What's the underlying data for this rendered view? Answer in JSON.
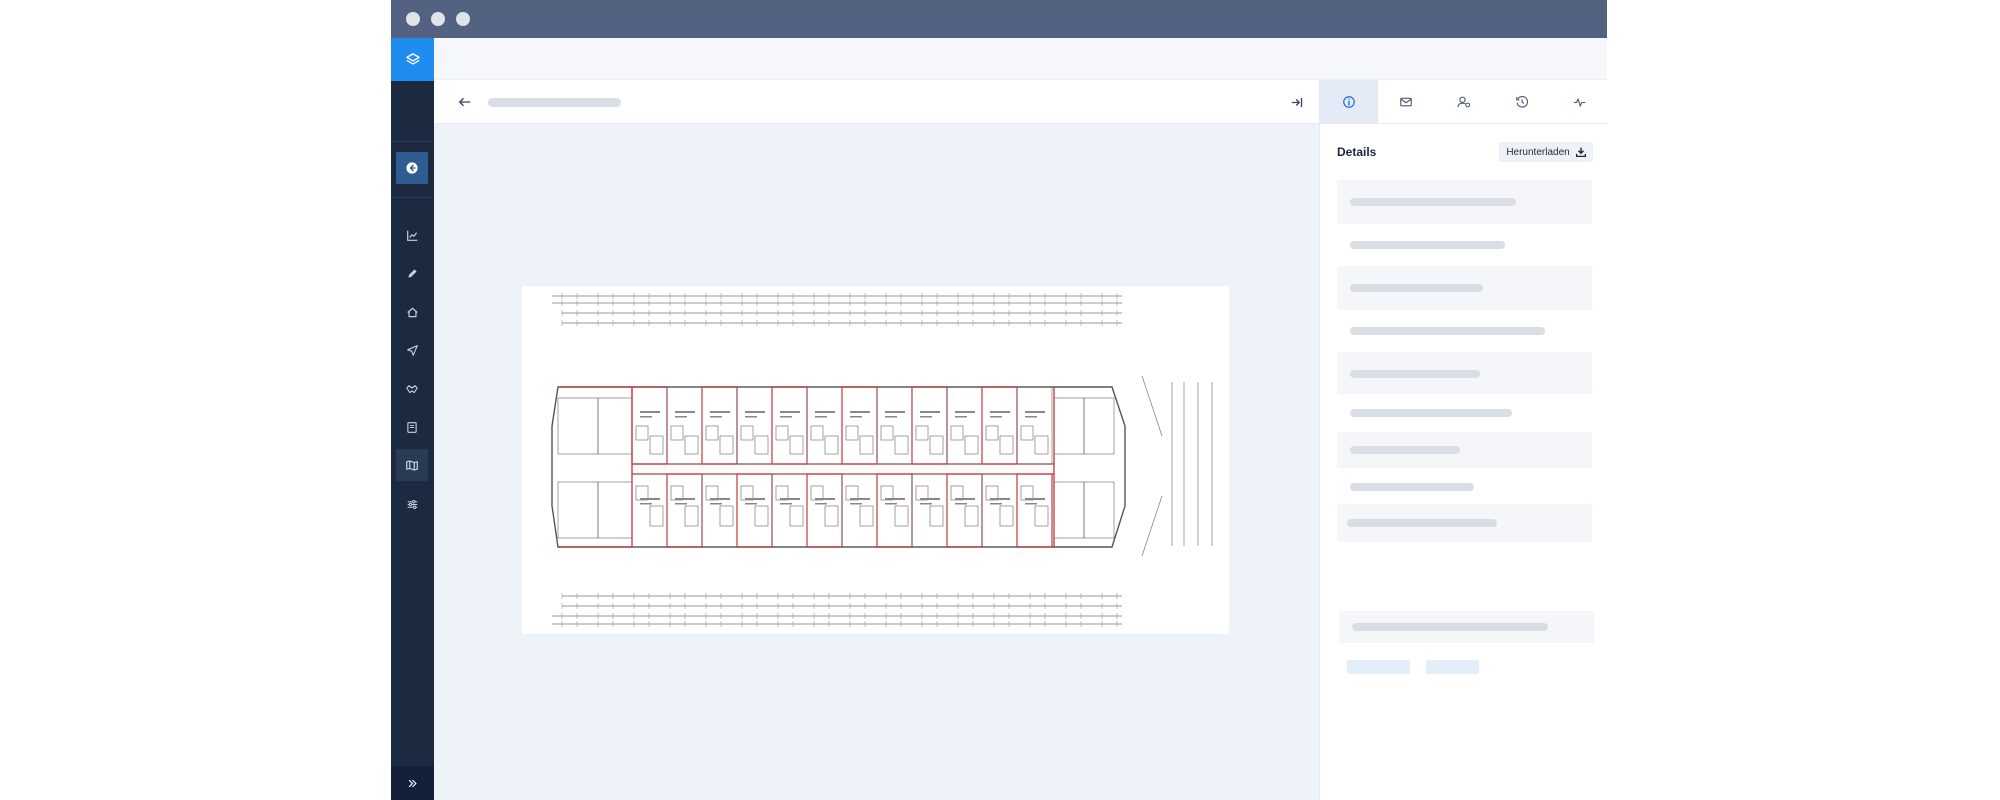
{
  "window": {
    "controls": [
      "close-dot",
      "minimize-dot",
      "maximize-dot"
    ]
  },
  "sidebar": {
    "logo_icon": "layers-icon",
    "back_icon": "circle-arrow-left-icon",
    "items": [
      {
        "icon": "chart-line-icon",
        "active": false
      },
      {
        "icon": "pen-icon",
        "active": false
      },
      {
        "icon": "home-icon",
        "active": false
      },
      {
        "icon": "paper-plane-icon",
        "active": false
      },
      {
        "icon": "handshake-icon",
        "active": false
      },
      {
        "icon": "book-icon",
        "active": false
      },
      {
        "icon": "map-icon",
        "active": true
      },
      {
        "icon": "sliders-icon",
        "active": false
      }
    ],
    "expand_icon": "chevron-double-right-icon"
  },
  "main": {
    "back_icon": "arrow-left-icon",
    "collapse_icon": "arrow-right-to-line-icon",
    "document": "floor-plan-image"
  },
  "panel": {
    "tabs": [
      {
        "icon": "info-icon",
        "active": true
      },
      {
        "icon": "envelope-icon",
        "active": false
      },
      {
        "icon": "user-settings-icon",
        "active": false
      },
      {
        "icon": "history-icon",
        "active": false
      },
      {
        "icon": "activity-icon",
        "active": false
      }
    ],
    "title": "Details",
    "download_label": "Herunterladen",
    "download_icon": "download-icon"
  },
  "colors": {
    "titlebar": "#536280",
    "sidebar": "#1c2a3f",
    "accent": "#1f8cf0",
    "plan_wall": "#c0393b"
  }
}
